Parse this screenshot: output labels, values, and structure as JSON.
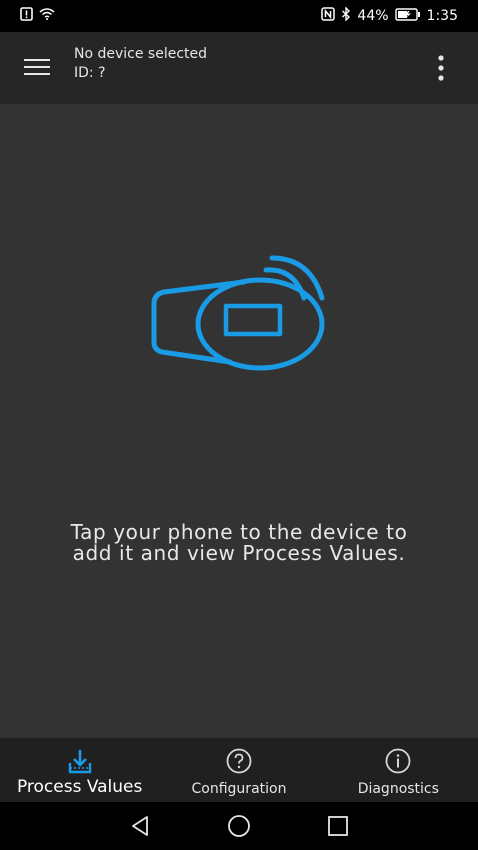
{
  "status_bar": {
    "battery_percent": "44%",
    "time": "1:35",
    "icons": [
      "sim-alert-icon",
      "wifi-icon",
      "nfc-icon",
      "bluetooth-icon",
      "battery-charging-icon"
    ]
  },
  "app_bar": {
    "title": "No device selected",
    "subtitle": "ID: ?",
    "menu_icon": "hamburger-menu-icon",
    "overflow_icon": "more-vertical-icon"
  },
  "main": {
    "illustration": "nfc-device-icon",
    "accent_color": "#1a9be6",
    "hint": "Tap your phone to the device to add it and view Process Values."
  },
  "bottom_nav": {
    "items": [
      {
        "label": "Process Values",
        "icon": "download-tray-icon",
        "active": true
      },
      {
        "label": "Configuration",
        "icon": "help-circle-icon",
        "active": false
      },
      {
        "label": "Diagnostics",
        "icon": "info-circle-icon",
        "active": false
      }
    ],
    "active_color": "#1a9be6"
  },
  "system_nav": {
    "icons": [
      "back-triangle-icon",
      "home-circle-icon",
      "recents-square-icon"
    ]
  }
}
